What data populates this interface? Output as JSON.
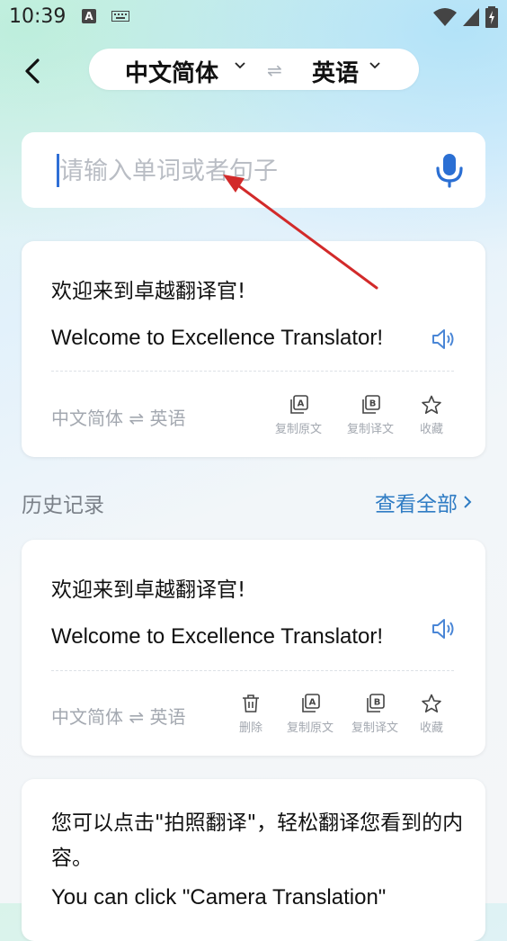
{
  "status_bar": {
    "time": "10:39",
    "a_badge": "A"
  },
  "header": {
    "source_language": "中文简体",
    "swap_symbol": "⇌",
    "target_language": "英语"
  },
  "input": {
    "placeholder": "请输入单词或者句子",
    "value": ""
  },
  "result_card": {
    "source_text": "欢迎来到卓越翻译官!",
    "translated_text": "Welcome to Excellence Translator!",
    "lang_pair": "中文简体 ⇌ 英语",
    "actions": {
      "copy_source": "复制原文",
      "copy_translation": "复制译文",
      "favorite": "收藏"
    }
  },
  "history": {
    "title": "历史记录",
    "view_all": "查看全部",
    "items": [
      {
        "source_text": "欢迎来到卓越翻译官!",
        "translated_text": "Welcome to Excellence Translator!",
        "lang_pair": "中文简体 ⇌ 英语",
        "actions": {
          "delete": "删除",
          "copy_source": "复制原文",
          "copy_translation": "复制译文",
          "favorite": "收藏"
        }
      },
      {
        "source_text": "您可以点击\"拍照翻译\"，轻松翻译您看到的内容。",
        "translated_text": "You can click \"Camera Translation\""
      }
    ]
  },
  "colors": {
    "accent": "#2f7cc4",
    "mic": "#2b6fd3",
    "muted": "#a3a8b0",
    "annotation_arrow": "#d22a2a"
  },
  "icons": [
    "back-arrow-icon",
    "chevron-down-icon",
    "swap-icon",
    "microphone-icon",
    "speaker-icon",
    "copy-source-icon",
    "copy-translation-icon",
    "star-icon",
    "trash-icon",
    "chevron-right-icon"
  ]
}
